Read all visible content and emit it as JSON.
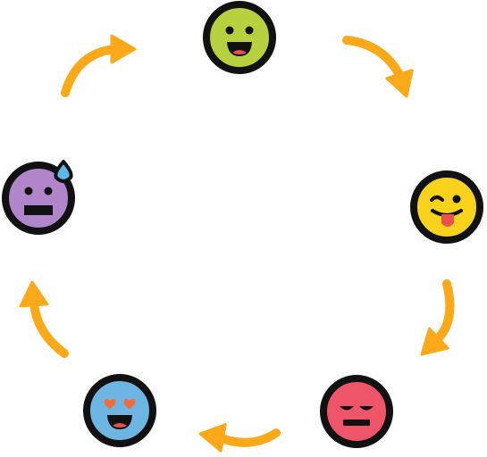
{
  "palette": {
    "outline": "#111111",
    "arrow": "#FBA919",
    "sweat_drop": "#5DB8E5",
    "tongue": "#E8524E",
    "heart": "#F26B3A"
  },
  "cycle": {
    "direction": "clockwise",
    "faces": [
      {
        "id": "happy",
        "icon": "smiling-face-icon",
        "fill": "#B7D13E",
        "expression": "open-mouth-smile"
      },
      {
        "id": "silly",
        "icon": "winking-tongue-face-icon",
        "fill": "#F9D21B",
        "expression": "wink-tongue-out"
      },
      {
        "id": "sad",
        "icon": "disappointed-face-icon",
        "fill": "#EE5568",
        "expression": "downcast-flat-mouth"
      },
      {
        "id": "in-love",
        "icon": "heart-eyes-face-icon",
        "fill": "#6DB6E4",
        "expression": "heart-eyes-smile"
      },
      {
        "id": "anxious",
        "icon": "sweating-face-icon",
        "fill": "#B085C9",
        "expression": "flat-mouth-sweat-drop"
      }
    ],
    "arrows": [
      {
        "from": "happy",
        "to": "silly",
        "icon": "curved-arrow-icon"
      },
      {
        "from": "silly",
        "to": "sad",
        "icon": "curved-arrow-icon"
      },
      {
        "from": "sad",
        "to": "in-love",
        "icon": "curved-arrow-icon"
      },
      {
        "from": "in-love",
        "to": "anxious",
        "icon": "curved-arrow-icon"
      },
      {
        "from": "anxious",
        "to": "happy",
        "icon": "curved-arrow-icon"
      }
    ]
  }
}
